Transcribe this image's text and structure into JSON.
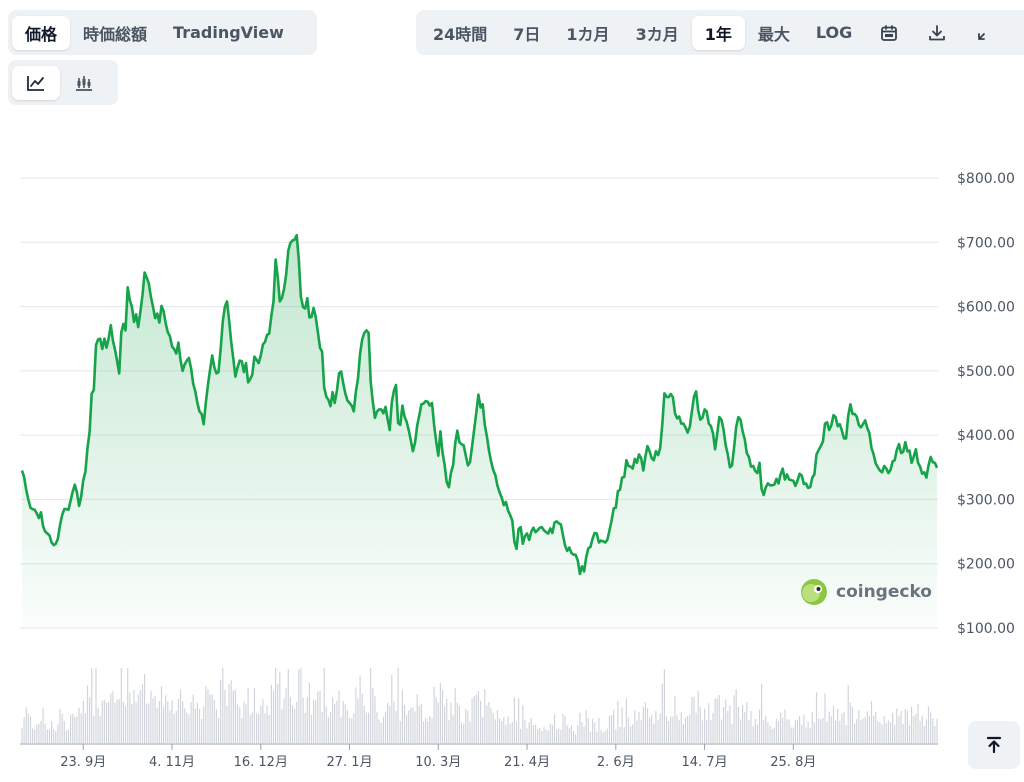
{
  "tabs": [
    {
      "label": "価格",
      "active": true
    },
    {
      "label": "時価総額",
      "active": false
    },
    {
      "label": "TradingView",
      "active": false
    }
  ],
  "ranges": [
    {
      "label": "24時間",
      "active": false
    },
    {
      "label": "7日",
      "active": false
    },
    {
      "label": "1カ月",
      "active": false
    },
    {
      "label": "3カ月",
      "active": false
    },
    {
      "label": "1年",
      "active": true
    },
    {
      "label": "最大",
      "active": false
    },
    {
      "label": "LOG",
      "active": false
    }
  ],
  "toolbar_icons": [
    "calendar-icon",
    "download-icon",
    "expand-icon"
  ],
  "chart_type_icons": [
    "line-chart-icon",
    "candlestick-chart-icon"
  ],
  "watermark": "coingecko",
  "colors": {
    "line": "#16a34a",
    "fill": "#16a34a",
    "grid": "#e5e7eb",
    "volume": "#d1d5db",
    "brand": "#8dc63f"
  },
  "chart_data": {
    "type": "area",
    "title": "",
    "xlabel": "",
    "ylabel": "",
    "ylim": [
      100,
      800
    ],
    "y_ticks": [
      800,
      700,
      600,
      500,
      400,
      300,
      200,
      100
    ],
    "y_tick_labels": [
      "$800.00",
      "$700.00",
      "$600.00",
      "$500.00",
      "$400.00",
      "$300.00",
      "$200.00",
      "$100.00"
    ],
    "x_tick_labels": [
      "23. 9月",
      "4. 11月",
      "16. 12月",
      "27. 1月",
      "10. 3月",
      "21. 4月",
      "2. 6月",
      "14. 7月",
      "25. 8月"
    ],
    "x_tick_index": [
      29,
      71,
      113,
      155,
      197,
      239,
      281,
      323,
      365
    ],
    "grid": true,
    "series": [
      {
        "values": [
          345,
          335,
          315,
          300,
          287,
          285,
          284,
          278,
          271,
          280,
          258,
          250,
          247,
          244,
          233,
          229,
          231,
          239,
          260,
          276,
          285,
          285,
          284,
          298,
          312,
          323,
          311,
          290,
          305,
          330,
          343,
          380,
          405,
          465,
          470,
          540,
          549,
          550,
          534,
          550,
          536,
          550,
          571,
          547,
          533,
          515,
          496,
          560,
          573,
          563,
          630,
          610,
          600,
          576,
          588,
          568,
          591,
          618,
          653,
          645,
          636,
          615,
          600,
          582,
          589,
          575,
          601,
          593,
          574,
          560,
          554,
          538,
          534,
          527,
          544,
          517,
          500,
          510,
          516,
          520,
          504,
          480,
          468,
          450,
          437,
          433,
          417,
          450,
          479,
          502,
          524,
          506,
          496,
          498,
          533,
          577,
          600,
          608,
          579,
          545,
          519,
          491,
          505,
          516,
          515,
          498,
          512,
          482,
          487,
          494,
          522,
          517,
          512,
          524,
          541,
          545,
          556,
          558,
          586,
          608,
          673,
          647,
          608,
          613,
          627,
          649,
          687,
          699,
          703,
          704,
          711,
          673,
          615,
          599,
          597,
          613,
          583,
          584,
          598,
          584,
          561,
          536,
          530,
          474,
          460,
          455,
          445,
          467,
          450,
          469,
          496,
          499,
          481,
          465,
          454,
          450,
          446,
          437,
          468,
          488,
          527,
          549,
          559,
          563,
          559,
          483,
          452,
          427,
          437,
          440,
          440,
          434,
          444,
          425,
          408,
          451,
          469,
          478,
          419,
          416,
          446,
          429,
          421,
          408,
          392,
          375,
          388,
          415,
          431,
          448,
          449,
          453,
          452,
          446,
          450,
          416,
          390,
          368,
          406,
          373,
          354,
          327,
          319,
          342,
          353,
          387,
          407,
          389,
          386,
          384,
          368,
          353,
          358,
          383,
          409,
          435,
          463,
          443,
          448,
          416,
          398,
          376,
          359,
          346,
          338,
          321,
          311,
          303,
          291,
          296,
          283,
          276,
          267,
          234,
          223,
          254,
          257,
          231,
          243,
          247,
          237,
          250,
          256,
          249,
          252,
          256,
          257,
          252,
          249,
          247,
          255,
          248,
          264,
          266,
          263,
          261,
          244,
          228,
          220,
          225,
          217,
          214,
          214,
          205,
          184,
          196,
          188,
          210,
          224,
          226,
          239,
          248,
          247,
          233,
          236,
          235,
          233,
          237,
          252,
          267,
          286,
          287,
          313,
          315,
          334,
          335,
          361,
          352,
          351,
          348,
          363,
          357,
          370,
          364,
          345,
          367,
          383,
          375,
          364,
          361,
          375,
          369,
          380,
          417,
          465,
          460,
          459,
          464,
          459,
          434,
          426,
          429,
          418,
          418,
          412,
          404,
          413,
          437,
          460,
          468,
          439,
          424,
          427,
          440,
          437,
          418,
          414,
          403,
          378,
          402,
          428,
          424,
          408,
          384,
          370,
          350,
          353,
          381,
          413,
          428,
          424,
          406,
          394,
          372,
          366,
          351,
          352,
          344,
          341,
          357,
          316,
          307,
          319,
          325,
          322,
          322,
          323,
          332,
          325,
          339,
          348,
          331,
          339,
          331,
          330,
          329,
          321,
          329,
          340,
          337,
          324,
          325,
          318,
          319,
          334,
          339,
          370,
          377,
          383,
          390,
          418,
          420,
          408,
          415,
          431,
          428,
          414,
          417,
          407,
          395,
          395,
          430,
          448,
          433,
          433,
          429,
          416,
          412,
          417,
          423,
          411,
          403,
          380,
          370,
          356,
          350,
          345,
          342,
          352,
          348,
          341,
          346,
          359,
          361,
          377,
          386,
          372,
          374,
          389,
          375,
          376,
          357,
          367,
          378,
          357,
          351,
          340,
          342,
          334,
          353,
          366,
          358,
          357,
          349
        ]
      }
    ]
  }
}
